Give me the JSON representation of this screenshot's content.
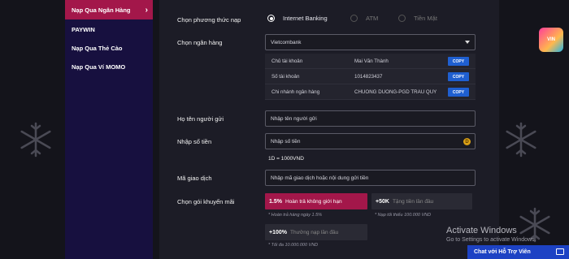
{
  "sidebar": {
    "items": [
      {
        "label": "Nạp Qua Ngân Hàng"
      },
      {
        "label": "PAYWIN"
      },
      {
        "label": "Nạp Qua Thẻ Cào"
      },
      {
        "label": "Nạp Qua Ví MOMO"
      }
    ]
  },
  "form": {
    "method_label": "Chọn phương thức nạp",
    "methods": [
      {
        "label": "Internet Banking",
        "selected": true
      },
      {
        "label": "ATM",
        "selected": false
      },
      {
        "label": "Tiền Mặt",
        "selected": false
      }
    ],
    "bank_label": "Chọn ngân hàng",
    "bank_value": "Vietcombank",
    "bank_details": [
      {
        "key": "Chủ tài khoản",
        "value": "Mai Văn Thành",
        "button": "COPY"
      },
      {
        "key": "Số tài khoản",
        "value": "1014823437",
        "button": "COPY"
      },
      {
        "key": "Chi nhánh ngân hàng",
        "value": "CHUONG DUONG-PGD TRAU QUY",
        "button": "COPY"
      }
    ],
    "sender_label": "Họ tên người gửi",
    "sender_placeholder": "Nhập tên người gửi",
    "amount_label": "Nhập số tiền",
    "amount_placeholder": "Nhập số tiền",
    "amount_coin": "D",
    "rate_text": "1D = 1000VND",
    "code_label": "Mã giao dịch",
    "code_placeholder": "Nhập mã giao dịch hoặc nội dung gửi tiền",
    "promo_label": "Chọn gói khuyến mãi",
    "promos": [
      {
        "value": "1.5%",
        "text": "Hoàn trả không giới hạn",
        "note": "* Hoàn trả hàng ngày 1.5%",
        "selected": true
      },
      {
        "value": "+50K",
        "text": "Tặng tiền lần đầu",
        "note": "* Nạp tối thiểu 100.000 VND",
        "selected": false
      },
      {
        "value": "+100%",
        "text": "Thưởng nạp lần đầu",
        "note": "* Tối đa 10.000.000 VND",
        "selected": false
      }
    ]
  },
  "overlay": {
    "watermark_title": "Activate Windows",
    "watermark_sub": "Go to Settings to activate Windows.",
    "chat_label": "Chat với Hỗ Trợ Viên",
    "logo_text": "VIN"
  },
  "colors": {
    "accent": "#a3174a",
    "sidebar_bg": "#17103f",
    "copy_button": "#1f5fd0",
    "chat_button": "#1d42c4"
  }
}
